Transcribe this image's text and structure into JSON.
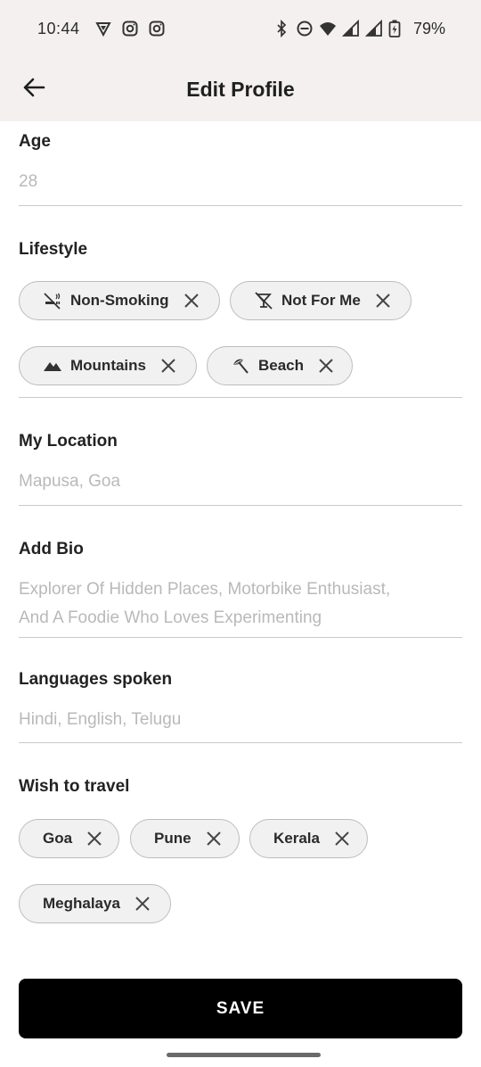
{
  "status_bar": {
    "time": "10:44",
    "battery": "79%",
    "icons_left": [
      "vpn-shield-icon",
      "instagram-icon",
      "instagram-icon"
    ],
    "icons_right": [
      "bluetooth-icon",
      "do-not-disturb-icon",
      "wifi-icon",
      "signal-icon",
      "signal-icon",
      "battery-icon"
    ]
  },
  "app_bar": {
    "title": "Edit Profile",
    "back_icon": "arrow-left-icon"
  },
  "form": {
    "age": {
      "label": "Age",
      "value": "28"
    },
    "lifestyle": {
      "label": "Lifestyle",
      "chips": [
        {
          "label": "Non-Smoking",
          "icon": "no-smoking-icon"
        },
        {
          "label": "Not For Me",
          "icon": "no-drinks-icon"
        },
        {
          "label": "Mountains",
          "icon": "mountains-icon"
        },
        {
          "label": "Beach",
          "icon": "beach-umbrella-icon"
        }
      ]
    },
    "location": {
      "label": "My Location",
      "value": "Mapusa, Goa"
    },
    "bio": {
      "label": "Add Bio",
      "value_line1": "Explorer Of Hidden Places, Motorbike Enthusiast,",
      "value_line2": "And A Foodie Who Loves Experimenting"
    },
    "languages": {
      "label": "Languages spoken",
      "value": "Hindi, English, Telugu"
    },
    "wish_to_travel": {
      "label": "Wish to travel",
      "chips": [
        {
          "label": "Goa"
        },
        {
          "label": "Pune"
        },
        {
          "label": "Kerala"
        },
        {
          "label": "Meghalaya"
        }
      ]
    }
  },
  "save_button": {
    "label": "SAVE"
  },
  "colors": {
    "app_bar_bg": "#f4f0f0",
    "chip_bg": "#f1f1f1",
    "save_bg": "#000000",
    "placeholder_text": "#b9b9b9"
  }
}
